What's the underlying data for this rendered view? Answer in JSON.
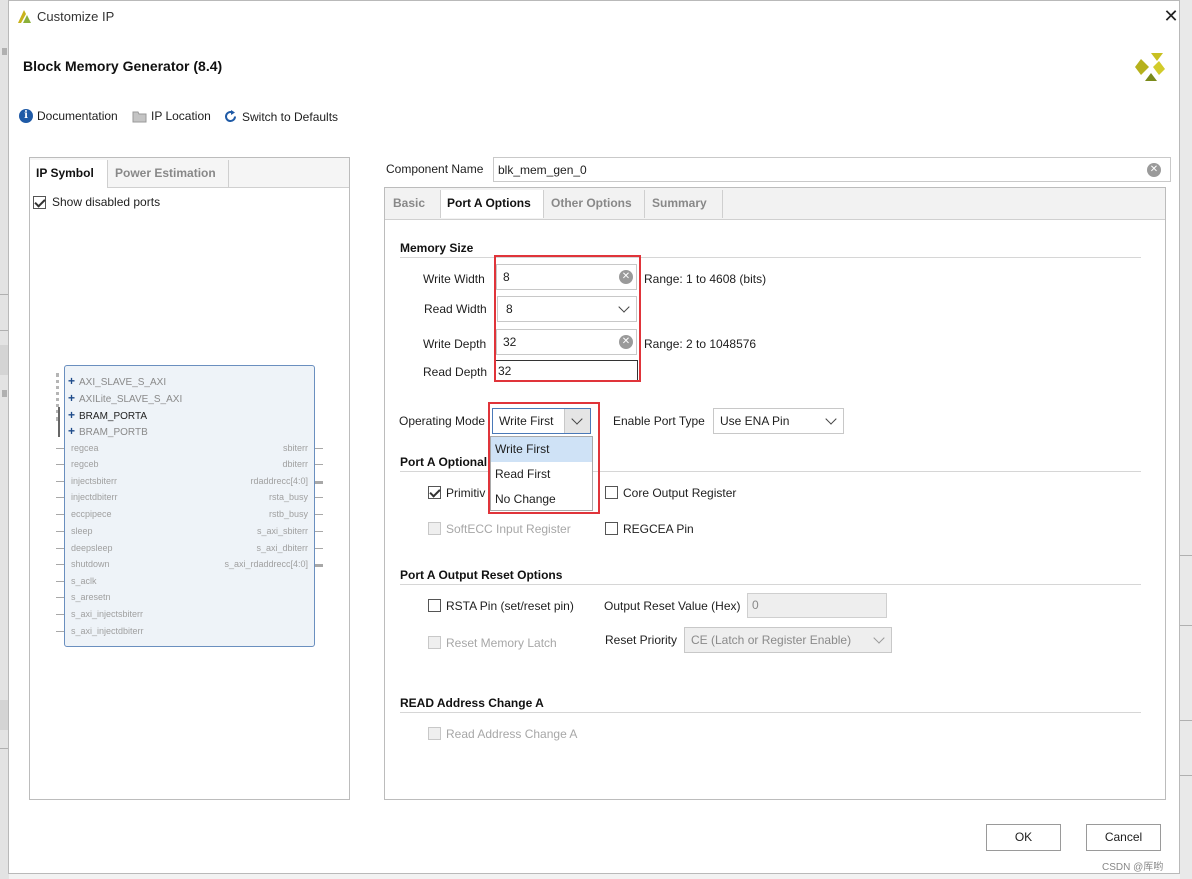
{
  "window": {
    "title": "Customize IP",
    "close_glyph": "✕"
  },
  "header": {
    "title": "Block Memory Generator (8.4)",
    "logo_icon": "xilinx-logo-icon"
  },
  "toolbar": {
    "documentation": "Documentation",
    "ip_location": "IP Location",
    "switch_defaults": "Switch to Defaults"
  },
  "left_panel": {
    "tabs": [
      "IP Symbol",
      "Power Estimation"
    ],
    "show_disabled_ports": "Show disabled ports",
    "bus_ports": [
      "AXI_SLAVE_S_AXI",
      "AXILite_SLAVE_S_AXI",
      "BRAM_PORTA",
      "BRAM_PORTB"
    ],
    "left_ports": [
      "regcea",
      "regceb",
      "injectsbiterr",
      "injectdbiterr",
      "eccpipece",
      "sleep",
      "deepsleep",
      "shutdown",
      "s_aclk",
      "s_aresetn",
      "s_axi_injectsbiterr",
      "s_axi_injectdbiterr"
    ],
    "right_ports": [
      "sbiterr",
      "dbiterr",
      "rdaddrecc[4:0]",
      "rsta_busy",
      "rstb_busy",
      "s_axi_sbiterr",
      "s_axi_dbiterr",
      "s_axi_rdaddrecc[4:0]"
    ]
  },
  "component": {
    "label": "Component Name",
    "value": "blk_mem_gen_0"
  },
  "tabs": [
    "Basic",
    "Port A Options",
    "Other Options",
    "Summary"
  ],
  "memory_size": {
    "title": "Memory Size",
    "write_width_label": "Write Width",
    "write_width": "8",
    "write_width_range": "Range: 1 to 4608 (bits)",
    "read_width_label": "Read Width",
    "read_width": "8",
    "write_depth_label": "Write Depth",
    "write_depth": "32",
    "write_depth_range": "Range: 2 to 1048576",
    "read_depth_label": "Read Depth",
    "read_depth": "32"
  },
  "operating_mode": {
    "label": "Operating Mode",
    "value": "Write First",
    "options": [
      "Write First",
      "Read First",
      "No Change"
    ],
    "enable_port_label": "Enable Port Type",
    "enable_port_value": "Use ENA Pin"
  },
  "optional_output": {
    "title": "Port A Optional",
    "primitives": "Primitiv",
    "core_output_register": "Core Output Register",
    "softecc": "SoftECC Input Register",
    "regcea_pin": "REGCEA Pin"
  },
  "output_reset": {
    "title": "Port A Output Reset Options",
    "rsta_pin": "RSTA Pin (set/reset pin)",
    "reset_value_label": "Output Reset Value (Hex)",
    "reset_value": "0",
    "reset_memory_latch": "Reset Memory Latch",
    "reset_priority_label": "Reset Priority",
    "reset_priority_value": "CE (Latch or Register Enable)"
  },
  "read_address": {
    "title": "READ Address Change A",
    "checkbox": "Read Address Change A"
  },
  "buttons": {
    "ok": "OK",
    "cancel": "Cancel"
  },
  "watermark": "CSDN @厍哟",
  "colors": {
    "highlight_box": "#e0343a",
    "selected_item": "#cfe2f6",
    "symbol_border": "#6a8fbf"
  }
}
